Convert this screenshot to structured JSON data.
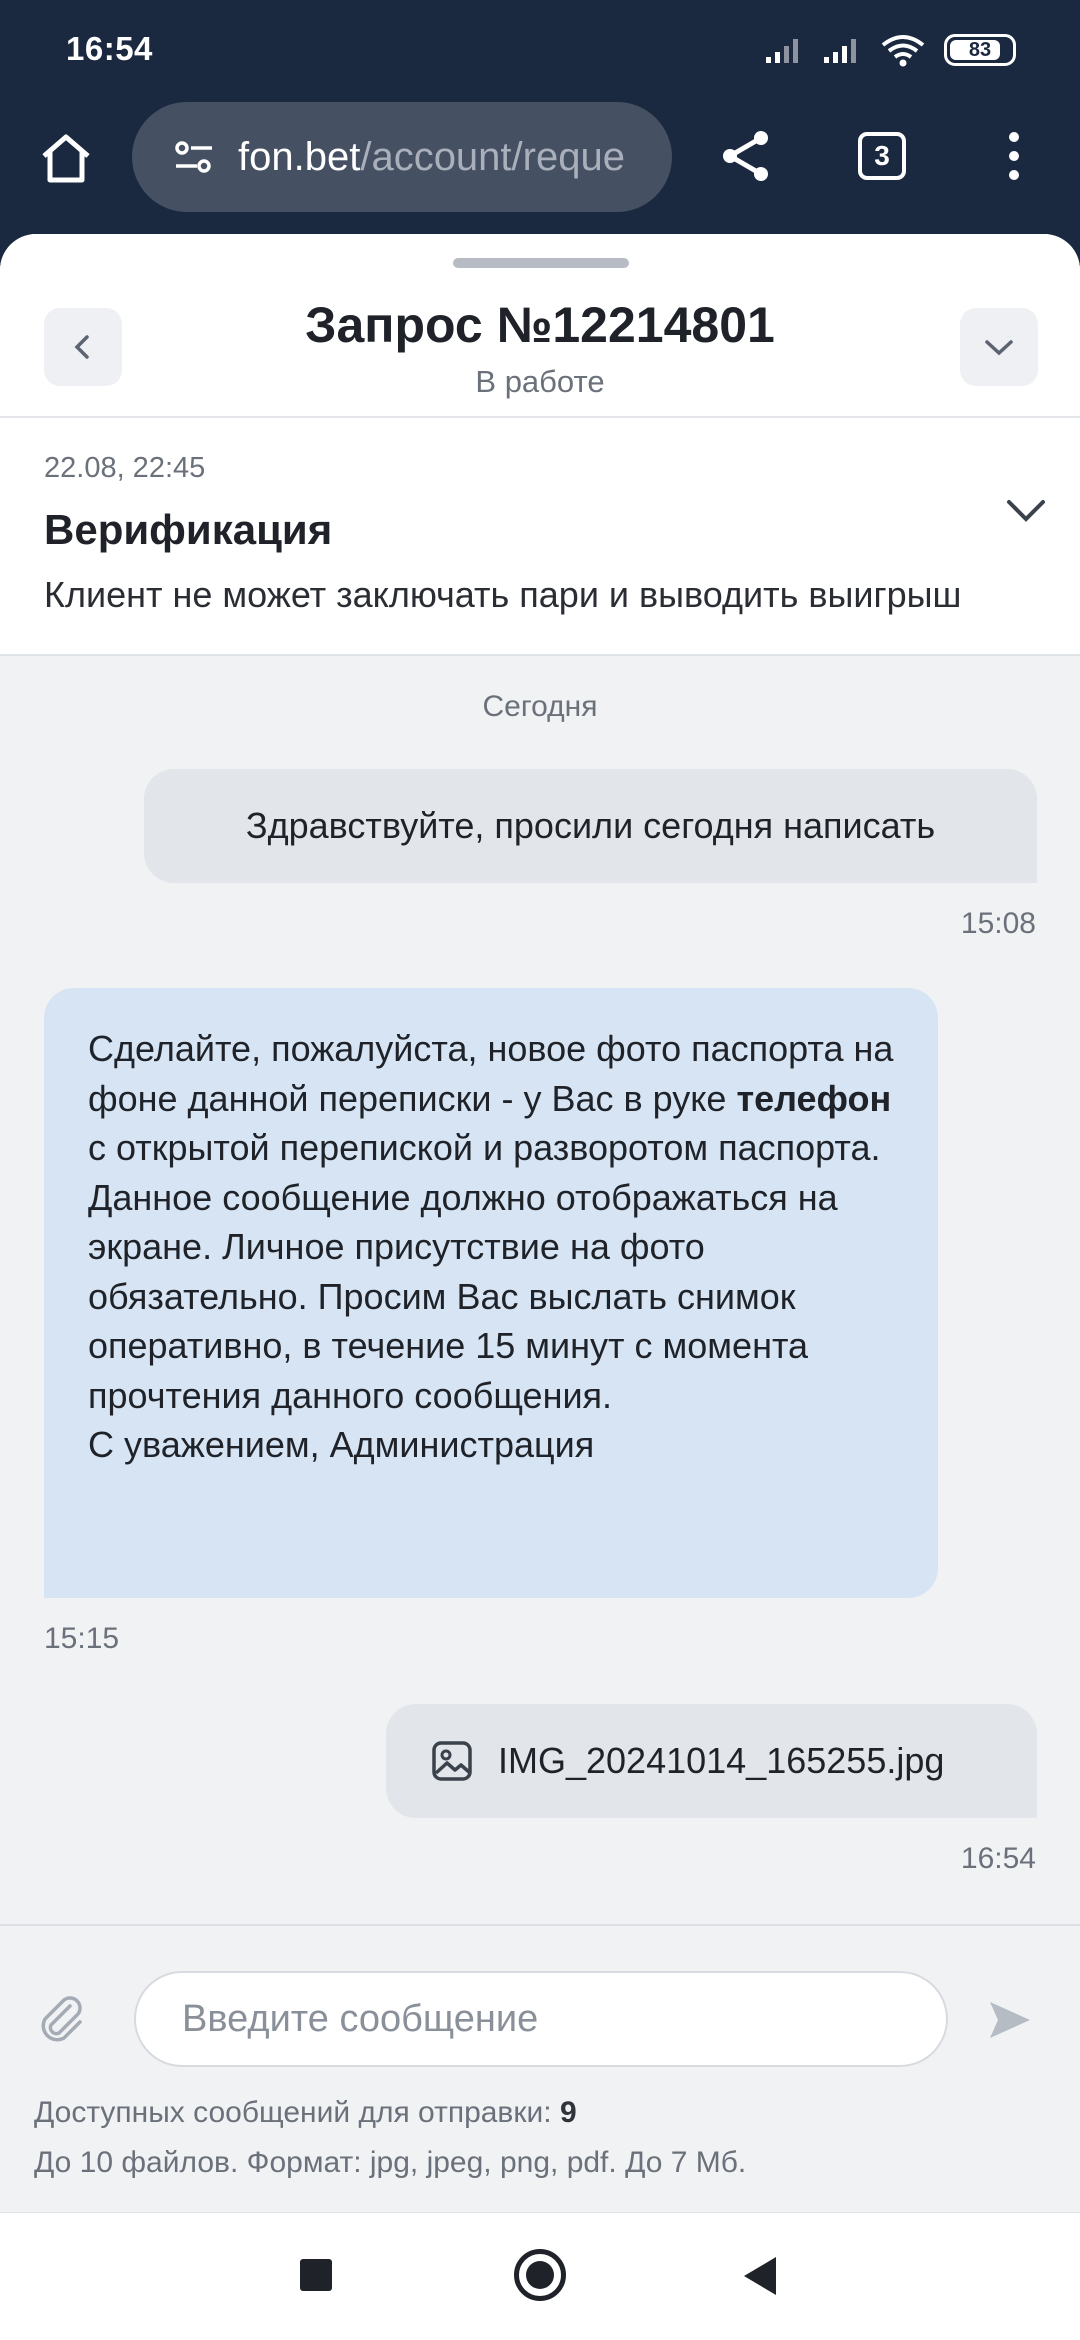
{
  "status_bar": {
    "time": "16:54",
    "battery": "83",
    "battery_level": 0.83
  },
  "browser": {
    "url_host": "fon.bet",
    "url_path": "/account/reque",
    "tab_count": "3",
    "icons": [
      "home-icon",
      "site-settings-icon",
      "share-icon",
      "tabs-icon",
      "more-menu-icon"
    ]
  },
  "request": {
    "title": "Запрос №12214801",
    "status": "В работе",
    "date": "22.08, 22:45",
    "topic": "Верификация",
    "description": "Клиент не может заключать пари и выводить выигрыш"
  },
  "chat": {
    "day_label": "Сегодня",
    "messages": [
      {
        "direction": "out",
        "text": "Здравствуйте, просили сегодня написать",
        "time": "15:08"
      },
      {
        "direction": "in",
        "text_before_bold": "Сделайте, пожалуйста, новое фото паспорта на фоне данной переписки - у Вас в руке ",
        "bold": "телефон",
        "text_after_bold": " с открытой перепиской и разворотом паспорта. Данное сообщение должно отображаться на экране. Личное присутствие на фото обязательно. Просим Вас выслать снимок оперативно, в течение 15 минут с момента прочтения данного сообщения.",
        "signature": "С уважением, Администрация",
        "time": "15:15"
      },
      {
        "direction": "out",
        "attachment": "IMG_20241014_165255.jpg",
        "time": "16:54"
      }
    ]
  },
  "composer": {
    "placeholder": "Введите сообщение",
    "value": "",
    "limit_label": "Доступных сообщений для отправки: ",
    "limit_count": "9",
    "files_hint": "До 10 файлов. Формат: jpg, jpeg, png, pdf. До 7 Мб."
  },
  "colors": {
    "top_bar": "#1b2940",
    "bubble_outgoing": "#e2e5ea",
    "bubble_incoming": "#d6e4f3",
    "chat_background": "#f1f2f4"
  }
}
